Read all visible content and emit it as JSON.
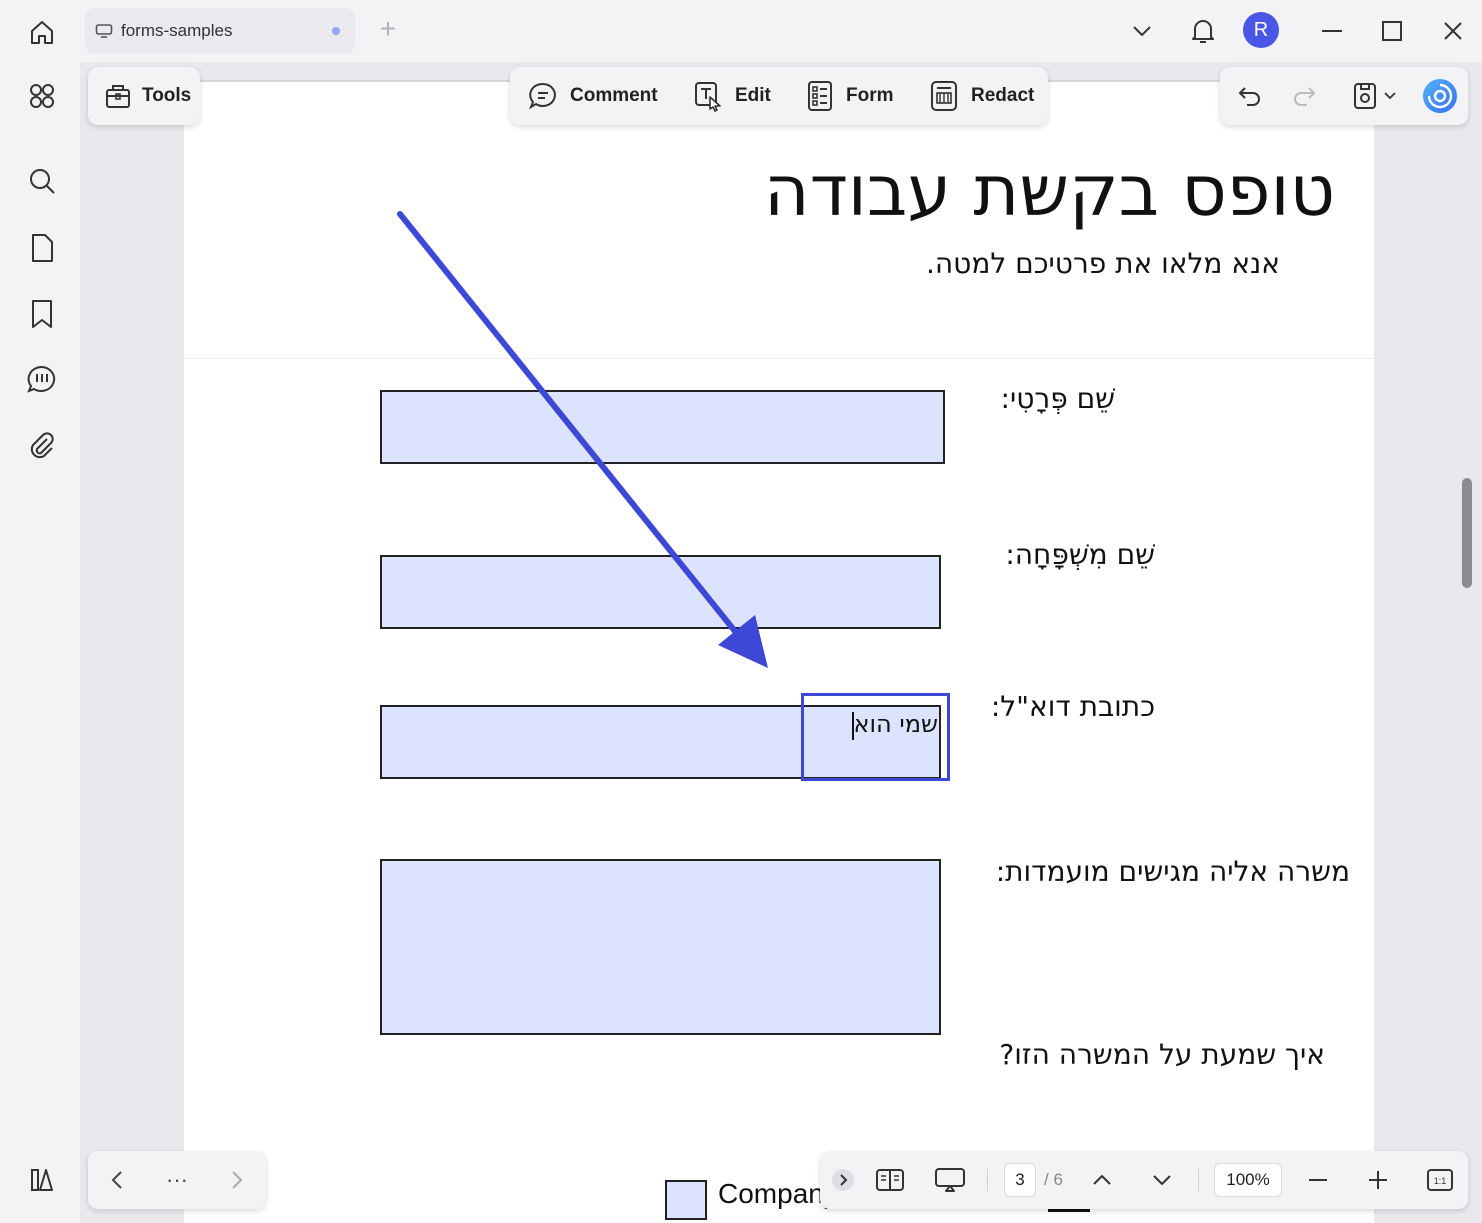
{
  "titlebar": {
    "tab_title": "forms-samples",
    "new_tab": "+",
    "avatar_initial": "R",
    "colors": {
      "avatar": "#4a57e6",
      "tab_dot": "#9aa3f2"
    }
  },
  "leftrail": {
    "items": [
      "apps-icon",
      "search-icon",
      "page-icon",
      "bookmark-icon",
      "comment-icon",
      "attachment-icon"
    ]
  },
  "toolbar": {
    "tools_label": "Tools",
    "comment_label": "Comment",
    "edit_label": "Edit",
    "form_label": "Form",
    "redact_label": "Redact"
  },
  "document": {
    "title": "טופס בקשת עבודה",
    "subtitle": "אנא מלאו את פרטיכם למטה.",
    "labels": {
      "first_name": "שֵׁם פְּרָטִי:",
      "last_name": "שֵׁם מִשְׁפָּחָה:",
      "email": "כתובת דוא\"ל:",
      "position": "משרה אליה מגישים מועמדות:",
      "heard_about": "איך שמעת על המשרה הזו?"
    },
    "email_field_value": "שמי הוא",
    "checkbox_label": "Company",
    "colors": {
      "field_fill": "#dce3fc",
      "annotation": "#3d49d6"
    }
  },
  "page_controls": {
    "current_page": "3",
    "total_pages": "/ 6",
    "zoom": "100%",
    "fit_label": "1:1"
  },
  "bottom_nav": {
    "more": "···"
  }
}
